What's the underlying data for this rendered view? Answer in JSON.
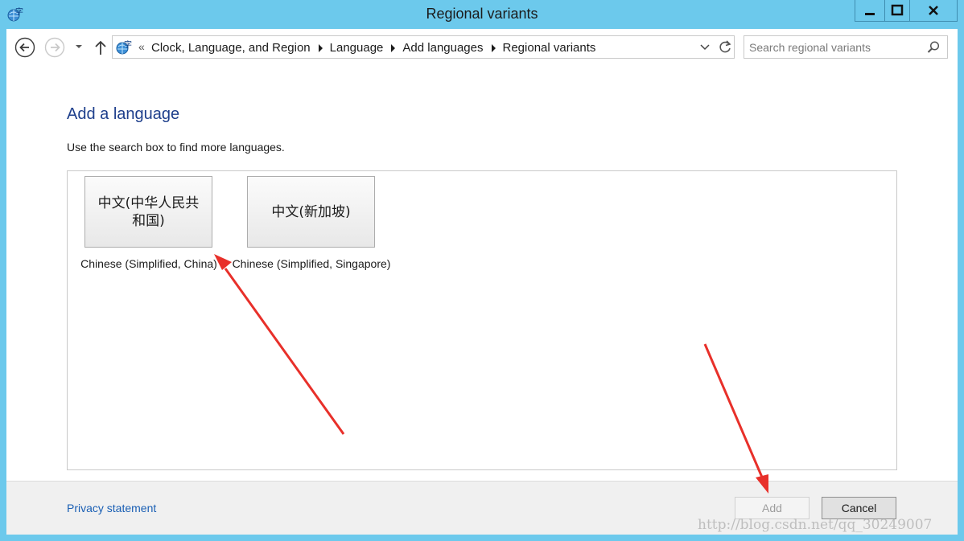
{
  "window": {
    "title": "Regional variants"
  },
  "navigation": {
    "back_icon": "back-arrow-icon",
    "forward_icon": "forward-arrow-icon",
    "up_icon": "up-arrow-icon",
    "breadcrumb_overflow": "«",
    "breadcrumbs": [
      "Clock, Language, and Region",
      "Language",
      "Add languages",
      "Regional variants"
    ]
  },
  "search": {
    "placeholder": "Search regional variants"
  },
  "content": {
    "title": "Add a language",
    "instruction": "Use the search box to find more languages.",
    "variants": [
      {
        "native_name": "中文(中华人民共和国)",
        "english_name": "Chinese (Simplified, China)"
      },
      {
        "native_name": "中文(新加坡)",
        "english_name": "Chinese (Simplified, Singapore)"
      }
    ]
  },
  "footer": {
    "privacy_link": "Privacy statement",
    "add_label": "Add",
    "cancel_label": "Cancel"
  },
  "watermark": "http://blog.csdn.net/qq_30249007",
  "colors": {
    "window_frame": "#6cc9ec",
    "title_link": "#1e3f8c",
    "link": "#1a5fb4",
    "annotation_arrow": "#e8302a"
  }
}
